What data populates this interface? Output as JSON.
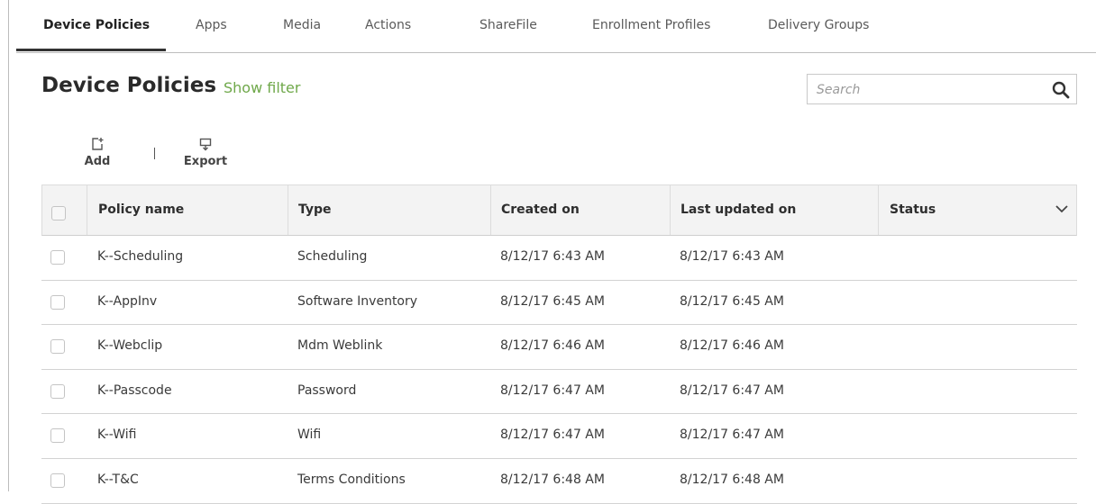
{
  "tabs": [
    {
      "label": "Device Policies",
      "active": true
    },
    {
      "label": "Apps"
    },
    {
      "label": "Media"
    },
    {
      "label": "Actions"
    },
    {
      "label": "ShareFile"
    },
    {
      "label": "Enrollment Profiles"
    },
    {
      "label": "Delivery Groups"
    }
  ],
  "header": {
    "title": "Device Policies",
    "show_filter": "Show filter"
  },
  "search": {
    "placeholder": "Search",
    "icon": "magnifier-icon"
  },
  "toolbar": {
    "add_label": "Add",
    "export_label": "Export"
  },
  "table": {
    "columns": [
      "Policy name",
      "Type",
      "Created on",
      "Last updated on",
      "Status"
    ],
    "rows": [
      {
        "name": "K--Scheduling",
        "type": "Scheduling",
        "created": "8/12/17 6:43 AM",
        "updated": "8/12/17 6:43 AM",
        "status": ""
      },
      {
        "name": "K--AppInv",
        "type": "Software Inventory",
        "created": "8/12/17 6:45 AM",
        "updated": "8/12/17 6:45 AM",
        "status": ""
      },
      {
        "name": "K--Webclip",
        "type": "Mdm Weblink",
        "created": "8/12/17 6:46 AM",
        "updated": "8/12/17 6:46 AM",
        "status": ""
      },
      {
        "name": "K--Passcode",
        "type": "Password",
        "created": "8/12/17 6:47 AM",
        "updated": "8/12/17 6:47 AM",
        "status": ""
      },
      {
        "name": "K--Wifi",
        "type": "Wifi",
        "created": "8/12/17 6:47 AM",
        "updated": "8/12/17 6:47 AM",
        "status": ""
      },
      {
        "name": "K--T&C",
        "type": "Terms Conditions",
        "created": "8/12/17 6:48 AM",
        "updated": "8/12/17 6:48 AM",
        "status": ""
      }
    ]
  },
  "colors": {
    "accent_green": "#6fa84a",
    "header_bg": "#f3f3f3"
  }
}
